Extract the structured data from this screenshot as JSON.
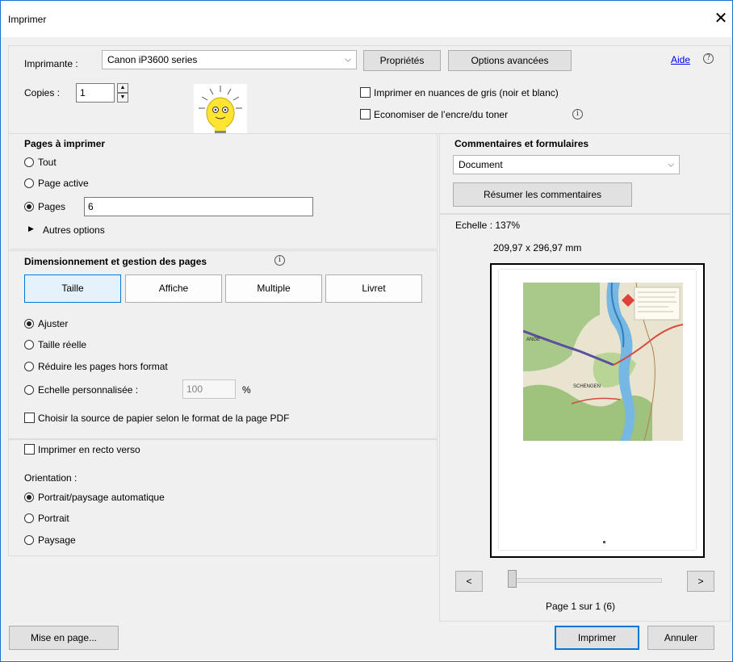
{
  "window": {
    "title": "Imprimer",
    "close_icon": "close-icon"
  },
  "printer": {
    "label": "Imprimante :",
    "selected": "Canon iP3600 series",
    "properties_button": "Propriétés",
    "advanced_button": "Options avancées",
    "help_link": "Aide",
    "copies_label": "Copies :",
    "copies_value": "1",
    "grayscale_label": "Imprimer en nuances de gris (noir et blanc)",
    "save_ink_label": "Economiser de l’encre/du toner"
  },
  "pages": {
    "heading": "Pages à imprimer",
    "all_label": "Tout",
    "current_label": "Page active",
    "pages_label": "Pages",
    "pages_value": "6",
    "more_options": "Autres options"
  },
  "sizing": {
    "heading": "Dimensionnement et gestion des pages",
    "tabs": [
      "Taille",
      "Affiche",
      "Multiple",
      "Livret"
    ],
    "fit_label": "Ajuster",
    "actual_label": "Taille réelle",
    "shrink_label": "Réduire les pages hors format",
    "custom_label": "Echelle personnalisée :",
    "custom_value": "100",
    "percent": "%",
    "paper_source_label": "Choisir la source de papier selon le format de la page PDF"
  },
  "duplex": {
    "label": "Imprimer en recto verso",
    "orientation_label": "Orientation :",
    "auto_label": "Portrait/paysage automatique",
    "portrait_label": "Portrait",
    "landscape_label": "Paysage"
  },
  "comments": {
    "heading": "Commentaires et formulaires",
    "selected": "Document",
    "summarize_button": "Résumer les commentaires"
  },
  "preview": {
    "scale": "Echelle : 137%",
    "dimensions": "209,97 x 296,97 mm",
    "prev": "<",
    "next": ">",
    "page_info": "Page 1 sur 1 (6)",
    "map_labels": [
      "SCHENGEN",
      "ANGE"
    ]
  },
  "footer": {
    "page_setup_button": "Mise en page...",
    "print_button": "Imprimer",
    "cancel_button": "Annuler"
  },
  "colors": {
    "accent": "#0078d7",
    "link": "#0000ee",
    "bulb": "#ffe433"
  }
}
